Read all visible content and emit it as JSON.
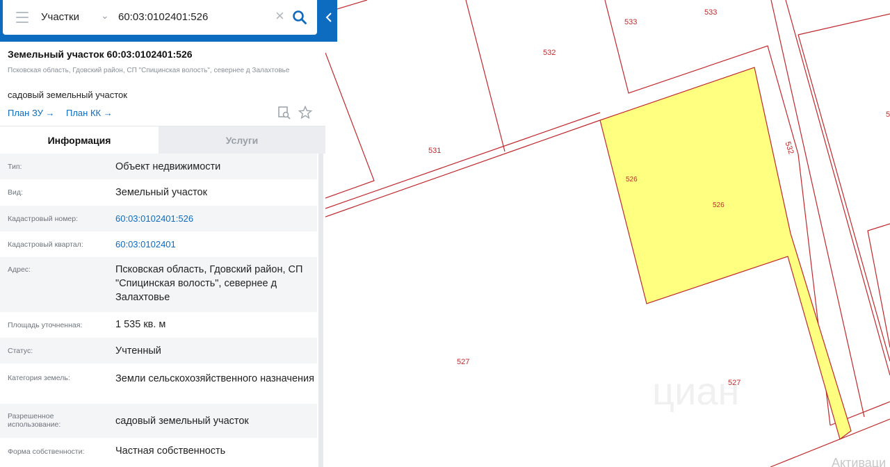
{
  "search": {
    "type_label": "Участки",
    "value": "60:03:0102401:526"
  },
  "parcel": {
    "title": "Земельный участок 60:03:0102401:526",
    "address_small": "Псковская область, Гдовский район, СП \"Спицинская волость\", севернее д Залахтовье",
    "purpose": "садовый земельный участок",
    "link_plan_zu": "План ЗУ →",
    "link_plan_kk": "План КК →"
  },
  "tabs": {
    "info": "Информация",
    "services": "Услуги"
  },
  "rows": [
    {
      "label": "Тип:",
      "value": "Объект недвижимости"
    },
    {
      "label": "Вид:",
      "value": "Земельный участок"
    },
    {
      "label": "Кадастровый номер:",
      "value": "60:03:0102401:526"
    },
    {
      "label": "Кадастровый квартал:",
      "value": "60:03:0102401"
    },
    {
      "label": "Адрес:",
      "value": "Псковская область, Гдовский район, СП \"Спицинская волость\", севернее д Залахтовье"
    },
    {
      "label": "Площадь уточненная:",
      "value": "1 535 кв. м"
    },
    {
      "label": "Статус:",
      "value": "Учтенный"
    },
    {
      "label": "Категория земель:",
      "value": "Земли сельскохозяйственного назначения"
    },
    {
      "label": "Разрешенное использование:",
      "value": "садовый земельный участок"
    },
    {
      "label": "Форма собственности:",
      "value": "Частная собственность"
    }
  ],
  "map": {
    "labels": [
      "533",
      "533",
      "532",
      "531",
      "532",
      "526",
      "526",
      "527",
      "527",
      "5"
    ],
    "watermark": "циан",
    "corner_text": "Активаци"
  },
  "colors": {
    "accent": "#0d6bc0",
    "parcel_fill": "#ffff80",
    "border": "#c0282c"
  }
}
